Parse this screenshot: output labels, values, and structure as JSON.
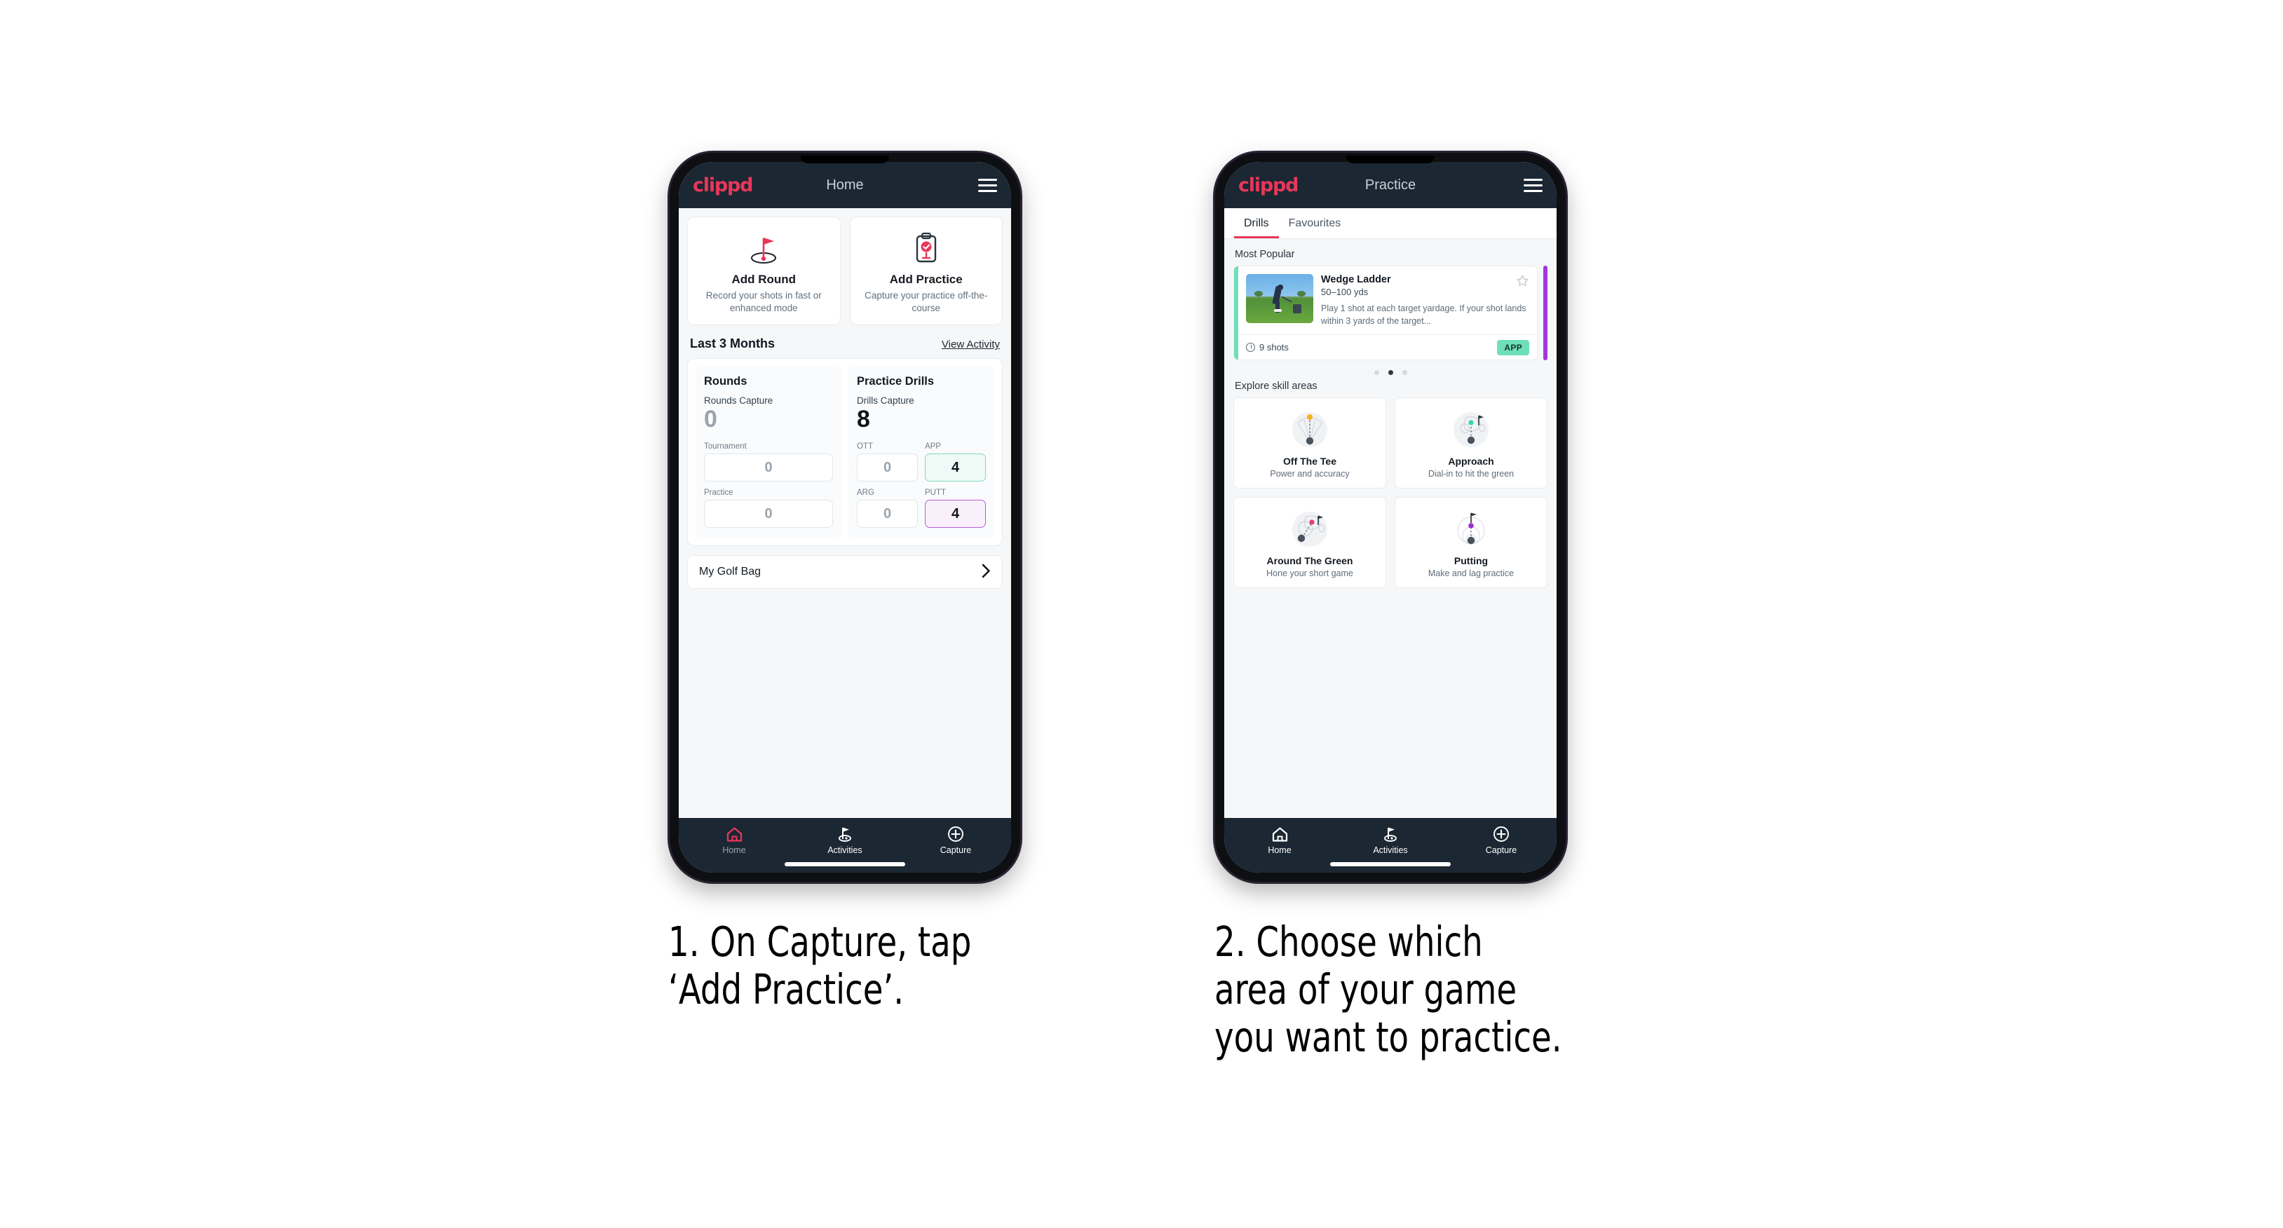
{
  "colors": {
    "brand_pink": "#e8375a",
    "appbar_dark": "#1b2733",
    "accent_green": "#6fdfb9",
    "accent_purple": "#a435e0",
    "field_green_border": "#7fd9bb",
    "field_purple_border": "#b05fd0"
  },
  "phone1": {
    "appbar": {
      "logo": "clippd",
      "title": "Home",
      "menu_icon": "hamburger-icon"
    },
    "actions": [
      {
        "icon": "golf-flag-hole-icon",
        "title": "Add Round",
        "subtitle": "Record your shots in fast or enhanced mode"
      },
      {
        "icon": "clipboard-check-tee-icon",
        "title": "Add Practice",
        "subtitle": "Capture your practice off-the-course"
      }
    ],
    "section": {
      "title": "Last 3 Months",
      "link": "View Activity"
    },
    "rounds": {
      "title": "Rounds",
      "capture_label": "Rounds Capture",
      "capture_value": "0",
      "fields": [
        {
          "label": "Tournament",
          "value": "0"
        },
        {
          "label": "Practice",
          "value": "0"
        }
      ]
    },
    "drills": {
      "title": "Practice Drills",
      "capture_label": "Drills Capture",
      "capture_value": "8",
      "fields": [
        {
          "label": "OTT",
          "value": "0",
          "highlight": "none"
        },
        {
          "label": "APP",
          "value": "4",
          "highlight": "green"
        },
        {
          "label": "ARG",
          "value": "0",
          "highlight": "none"
        },
        {
          "label": "PUTT",
          "value": "4",
          "highlight": "purple"
        }
      ]
    },
    "golf_bag": {
      "label": "My Golf Bag",
      "chevron": "chevron-right-icon"
    },
    "nav": [
      {
        "icon": "home-icon",
        "label": "Home",
        "active": true
      },
      {
        "icon": "golf-flag-icon",
        "label": "Activities",
        "active": false
      },
      {
        "icon": "plus-circle-icon",
        "label": "Capture",
        "active": false
      }
    ]
  },
  "phone2": {
    "appbar": {
      "logo": "clippd",
      "title": "Practice",
      "menu_icon": "hamburger-icon"
    },
    "tabs": [
      {
        "label": "Drills",
        "active": true
      },
      {
        "label": "Favourites",
        "active": false
      }
    ],
    "most_popular": {
      "heading": "Most Popular",
      "drill": {
        "name": "Wedge Ladder",
        "yardage": "50–100 yds",
        "description": "Play 1 shot at each target yardage. If your shot lands within 3 yards of the target...",
        "shots": "9 shots",
        "shots_icon": "clock-icon",
        "badge": "APP",
        "favourite_icon": "star-outline-icon",
        "thumbnail": "golfer-wedge-shot-photo"
      },
      "carousel_dots": {
        "count": 3,
        "active_index": 1
      }
    },
    "skill_areas": {
      "heading": "Explore skill areas",
      "cards": [
        {
          "icon": "off-the-tee-icon",
          "title": "Off The Tee",
          "subtitle": "Power and accuracy"
        },
        {
          "icon": "approach-icon",
          "title": "Approach",
          "subtitle": "Dial-in to hit the green"
        },
        {
          "icon": "around-the-green-icon",
          "title": "Around The Green",
          "subtitle": "Hone your short game"
        },
        {
          "icon": "putting-icon",
          "title": "Putting",
          "subtitle": "Make and lag practice"
        }
      ]
    },
    "nav": [
      {
        "icon": "home-icon",
        "label": "Home",
        "active": false
      },
      {
        "icon": "golf-flag-icon",
        "label": "Activities",
        "active": false
      },
      {
        "icon": "plus-circle-icon",
        "label": "Capture",
        "active": false
      }
    ]
  },
  "captions": {
    "step1": "1. On Capture, tap\n‘Add Practice’.",
    "step2": "2. Choose which\narea of your game\nyou want to practice."
  }
}
